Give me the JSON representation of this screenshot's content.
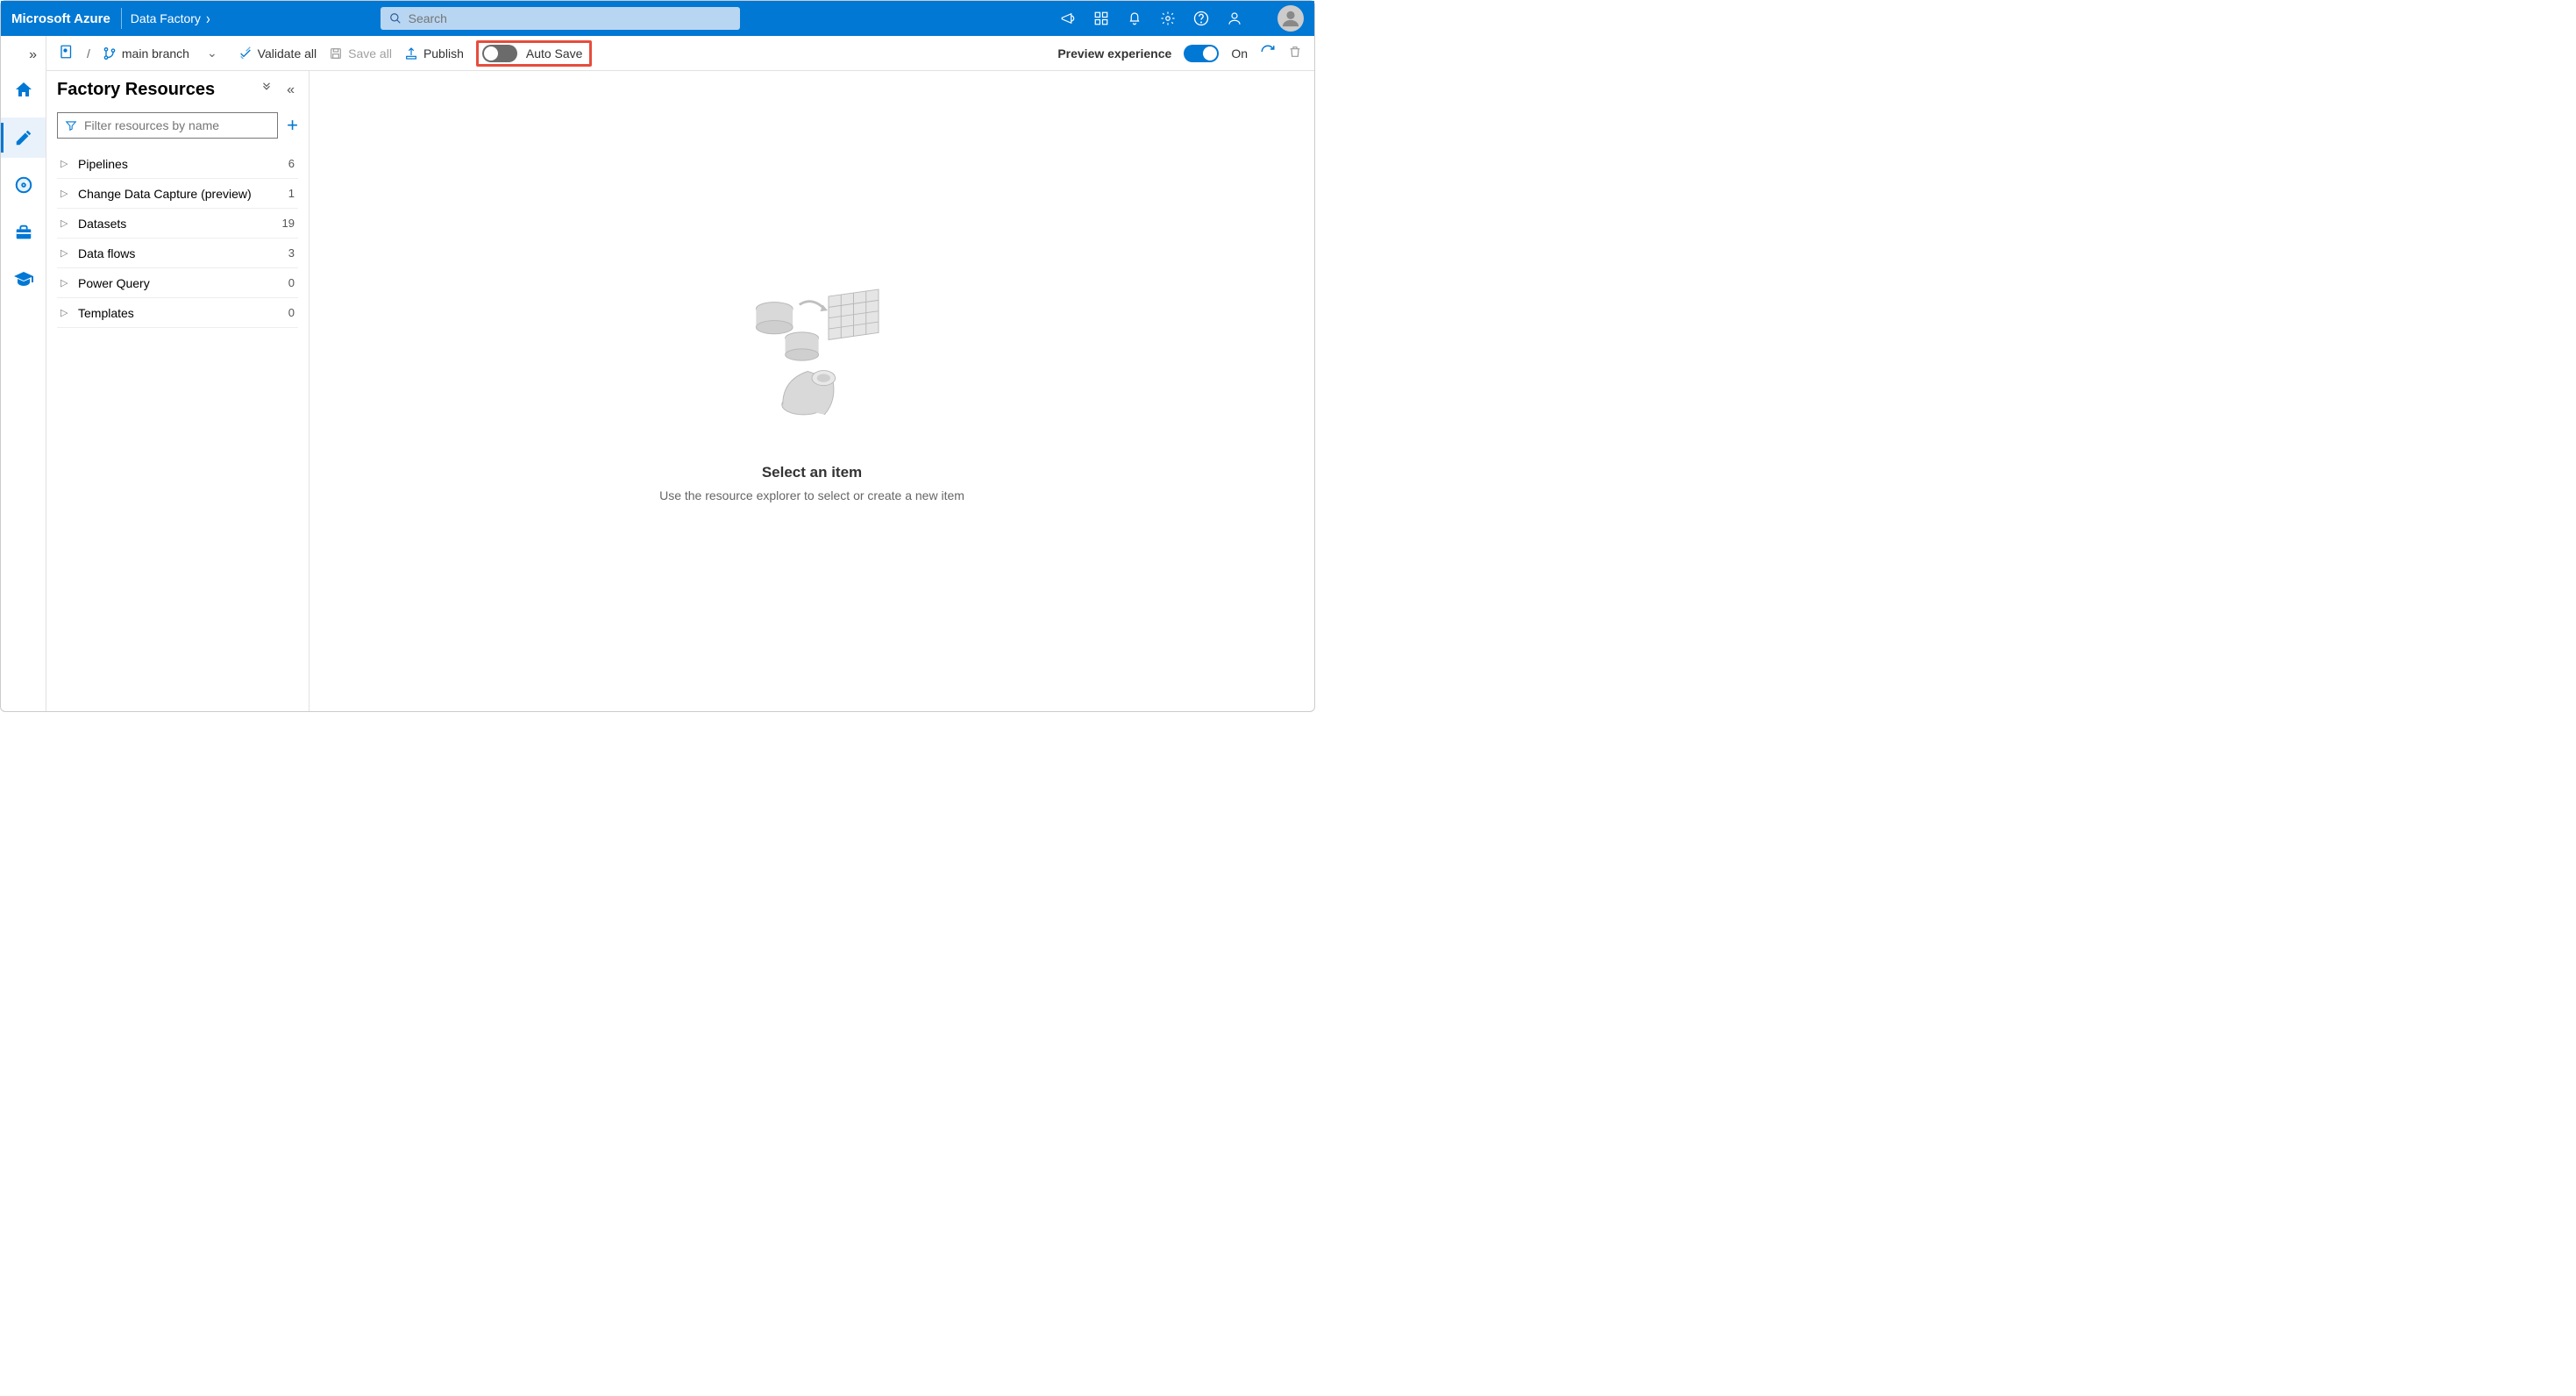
{
  "header": {
    "brand": "Microsoft Azure",
    "service": "Data Factory",
    "search_placeholder": "Search"
  },
  "toolbar": {
    "branch_label": "main branch",
    "validate_label": "Validate all",
    "save_all_label": "Save all",
    "publish_label": "Publish",
    "autosave_label": "Auto Save",
    "preview_label": "Preview experience",
    "preview_state": "On"
  },
  "explorer": {
    "title": "Factory Resources",
    "filter_placeholder": "Filter resources by name",
    "items": [
      {
        "label": "Pipelines",
        "count": "6"
      },
      {
        "label": "Change Data Capture (preview)",
        "count": "1"
      },
      {
        "label": "Datasets",
        "count": "19"
      },
      {
        "label": "Data flows",
        "count": "3"
      },
      {
        "label": "Power Query",
        "count": "0"
      },
      {
        "label": "Templates",
        "count": "0"
      }
    ]
  },
  "canvas": {
    "heading": "Select an item",
    "sub": "Use the resource explorer to select or create a new item"
  }
}
